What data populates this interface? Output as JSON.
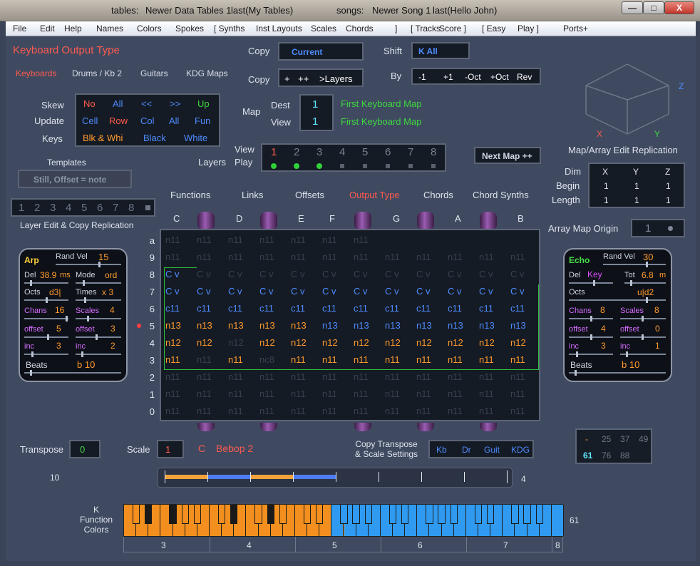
{
  "titlebar": {
    "tables": "tables:",
    "tables_value": "Newer Data Tables 1",
    "tables_last": "last(My Tables)",
    "songs": "songs:",
    "songs_value": "Newer Song 1",
    "songs_last": "last(Hello John)",
    "min": "—",
    "max": "□",
    "close": "X"
  },
  "menu": [
    "File",
    "Edit",
    "Help",
    "Names",
    "Colors",
    "Spokes",
    "[  Synths",
    "Inst Layouts",
    "Scales",
    "Chords",
    "]",
    "[  Tracks",
    "Score  ]",
    "[  Easy",
    "Play  ]",
    "Ports+"
  ],
  "header": {
    "title": "Keyboard  Output Type",
    "tabs": [
      "Keyboards",
      "Drums / Kb 2",
      "Guitars",
      "KDG Maps"
    ]
  },
  "copy": {
    "label": "Copy",
    "value": "Current",
    "copy2": "Copy",
    "buttons": [
      "+",
      "++",
      ">Layers"
    ],
    "shift": "Shift",
    "shift_value": "K  All",
    "by": "By",
    "by_buttons": [
      "-1",
      "+1",
      "-Oct",
      "+Oct",
      "Rev"
    ]
  },
  "skew": {
    "labels": [
      "Skew",
      "Update",
      "Keys"
    ],
    "row1": [
      "No",
      "All",
      "<<",
      ">>",
      "Up"
    ],
    "row2": [
      "Cell",
      "Row",
      "Col",
      "All",
      "Fun"
    ],
    "row3": [
      "Blk & Whi",
      "Black",
      "White"
    ]
  },
  "map": {
    "label": "Map",
    "dest": "Dest",
    "view": "View",
    "dest_val": "1",
    "view_val": "1",
    "dest_name": "First Keyboard Map",
    "view_name": "First Keyboard Map"
  },
  "layers": {
    "label": "Layers",
    "view": "View",
    "play": "Play",
    "nums": [
      "1",
      "2",
      "3",
      "4",
      "5",
      "6",
      "7",
      "8"
    ],
    "next": "Next Map ++"
  },
  "templates": {
    "label": "Templates",
    "value": "Still, Offset = note"
  },
  "layer_edit": {
    "nums": [
      "1",
      "2",
      "3",
      "4",
      "5",
      "6",
      "7",
      "8"
    ],
    "label": "Layer Edit & Copy Replication"
  },
  "nav_tabs": [
    "Functions",
    "Links",
    "Offsets",
    "Output Type",
    "Chords",
    "Chord Synths"
  ],
  "col_notes": [
    "C",
    "D",
    "E",
    "F",
    "G",
    "A",
    "B"
  ],
  "rows": [
    "a",
    "9",
    "8",
    "7",
    "6",
    "5",
    "4",
    "3",
    "2",
    "1",
    "0"
  ],
  "grid": {
    "r_a": [
      "n11",
      "n11",
      "n11",
      "n11",
      "n11",
      "n11",
      "n11",
      "n11",
      "n11",
      "n11",
      "n11",
      "n11"
    ],
    "r_8": [
      "C v",
      "C v",
      "C v",
      "C v",
      "C v",
      "C v",
      "C v",
      "C v",
      "C v",
      "C v",
      "C v",
      "C v"
    ],
    "r_7": [
      "C  v",
      "C  v",
      "C  v",
      "C  v",
      "C  v",
      "C  v",
      "C  v",
      "C  v",
      "C  v",
      "C  v",
      "C  v",
      "C  v"
    ],
    "r_6": [
      "c11",
      "c11",
      "c11",
      "c11",
      "c11",
      "c11",
      "c11",
      "c11",
      "c11",
      "c11",
      "c11",
      "c11"
    ],
    "r_5": [
      "n13",
      "n13",
      "n13",
      "n13",
      "n13",
      "n13",
      "n13",
      "n13",
      "n13",
      "n13",
      "n13",
      "n13"
    ],
    "r_4": [
      "n12",
      "n12",
      "n12",
      "n12",
      "n12",
      "n12",
      "n12",
      "n12",
      "n12",
      "n12",
      "n12",
      "n12"
    ],
    "r_3": [
      "n11",
      "n11",
      "n11",
      "nc8",
      "n11",
      "n11",
      "n11",
      "n11",
      "n11",
      "n11",
      "n11",
      "n11"
    ]
  },
  "arp": {
    "title": "Arp",
    "randvel": "Rand Vel",
    "randvel_v": "15",
    "del": "Del",
    "del_v": "38.9",
    "ms": "ms",
    "mode": "Mode",
    "mode_v": "ord",
    "octs": "Octs",
    "octs_v": "d3|",
    "times": "Times",
    "times_v": "x 3",
    "chans": "Chans",
    "chans_v": "16",
    "scales": "Scales",
    "scales_v": "4",
    "offset": "offset",
    "offset_v": "5",
    "offset2_v": "3",
    "inc": "inc",
    "inc_v": "3",
    "inc2_v": "2",
    "beats": "Beats",
    "beats_v": "b  10"
  },
  "echo": {
    "title": "Echo",
    "randvel": "Rand Vel",
    "randvel_v": "30",
    "del": "Del",
    "key": "Key",
    "tot": "Tot",
    "tot_v": "6.8",
    "m": "m",
    "octs": "Octs",
    "octs_v": "u|d2",
    "chans": "Chans",
    "chans_v": "8",
    "scales": "Scales",
    "scales_v": "8",
    "offset": "offset",
    "offset_v": "4",
    "offset2_v": "0",
    "inc": "inc",
    "inc_v": "3",
    "inc2_v": "1",
    "beats": "Beats",
    "beats_v": "b  10"
  },
  "replication": {
    "title": "Map/Array Edit Replication",
    "x": "X",
    "y": "Y",
    "z": "Z",
    "dim": "Dim",
    "begin": "Begin",
    "length": "Length",
    "dim_vals": [
      "X",
      "Y",
      "Z"
    ],
    "begin_vals": [
      "1",
      "1",
      "1"
    ],
    "length_vals": [
      "1",
      "1",
      "1"
    ],
    "origin": "Array Map Origin",
    "origin_v": "1"
  },
  "transpose": {
    "label": "Transpose",
    "value": "0",
    "scale": "Scale",
    "scale_v": "1",
    "note": "C",
    "scale_name": "Bebop  2",
    "copy": "Copy Transpose\n& Scale Settings",
    "btns": [
      "Kb",
      "Dr",
      "Guit",
      "KDG"
    ]
  },
  "numpad": {
    "row1": [
      "-",
      "25",
      "37",
      "49"
    ],
    "row2": [
      "61",
      "76",
      "88"
    ]
  },
  "range": {
    "left": "10",
    "right": "4"
  },
  "keyboard": {
    "label": "K\nFunction\nColors",
    "right": "61",
    "octaves": [
      "3",
      "4",
      "5",
      "6",
      "7",
      "8"
    ]
  }
}
